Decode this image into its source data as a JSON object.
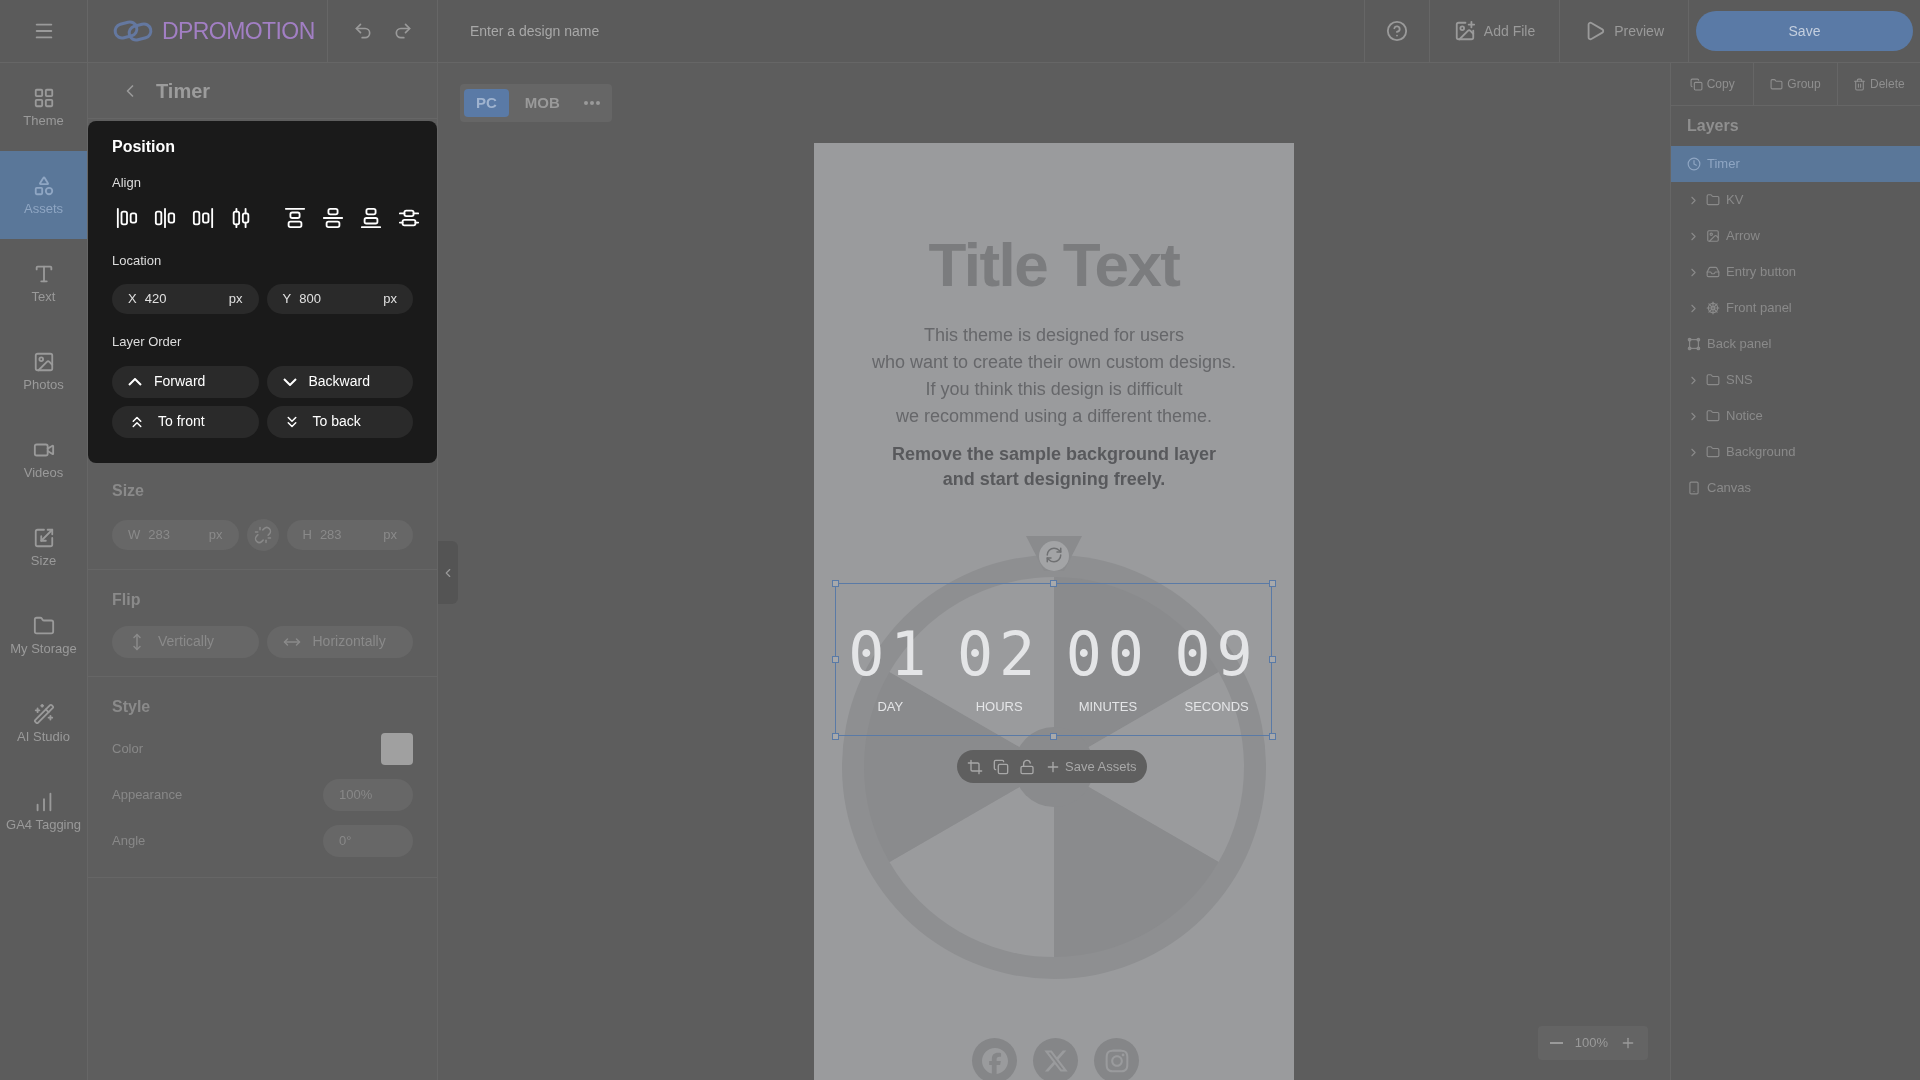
{
  "top_bar": {
    "logo": "DPROMOTION",
    "design_name": {
      "placeholder": "Enter a design name"
    },
    "actions": [
      {
        "label": "Add File",
        "kind": "add-image"
      },
      {
        "label": "Preview",
        "kind": "play"
      }
    ],
    "save": "Save"
  },
  "rail": [
    {
      "label": "Theme",
      "kind": "theme",
      "selected": false
    },
    {
      "label": "Assets",
      "kind": "assets",
      "selected": true
    },
    {
      "label": "Text",
      "kind": "text",
      "selected": false
    },
    {
      "label": "Photos",
      "kind": "photos",
      "selected": false
    },
    {
      "label": "Videos",
      "kind": "videos",
      "selected": false
    },
    {
      "label": "Size",
      "kind": "size",
      "selected": false
    },
    {
      "label": "My Storage",
      "kind": "storage",
      "selected": false
    },
    {
      "label": "AI Studio",
      "kind": "ai",
      "selected": false
    },
    {
      "label": "GA4 Tagging",
      "kind": "ga4",
      "selected": false
    }
  ],
  "panel": {
    "title": "Timer",
    "position": {
      "title": "Position",
      "align_label": "Align",
      "location_label": "Location",
      "x": {
        "axis": "X",
        "value": "420",
        "unit": "px"
      },
      "y": {
        "axis": "Y",
        "value": "800",
        "unit": "px"
      },
      "layer_order_label": "Layer Order",
      "order_buttons": [
        {
          "label": "Forward",
          "kind": "up"
        },
        {
          "label": "Backward",
          "kind": "down"
        },
        {
          "label": "To front",
          "kind": "top"
        },
        {
          "label": "To back",
          "kind": "bottom"
        }
      ]
    },
    "size": {
      "title": "Size",
      "w": {
        "axis": "W",
        "value": "283",
        "unit": "px"
      },
      "h": {
        "axis": "H",
        "value": "283",
        "unit": "px"
      }
    },
    "flip": {
      "title": "Flip",
      "buttons": [
        {
          "label": "Vertically",
          "kind": "vertical"
        },
        {
          "label": "Horizontally",
          "kind": "horizontal"
        }
      ]
    },
    "style": {
      "title": "Style",
      "color_label": "Color",
      "color": "#a0a0a0",
      "appearance_label": "Appearance",
      "appearance": "100%",
      "angle_label": "Angle",
      "angle": "0°"
    }
  },
  "view_tabs": [
    {
      "label": "PC",
      "selected": true
    },
    {
      "label": "MOB",
      "selected": false
    }
  ],
  "artboard": {
    "title": "Title Text",
    "body": [
      "This theme is designed for users",
      "who want to create their own custom designs.",
      "If you think this design is difficult",
      "we recommend using a different theme."
    ],
    "emphasis": [
      "Remove the sample background layer",
      "and start designing freely."
    ],
    "timer": [
      {
        "value": "01",
        "label": "DAY"
      },
      {
        "value": "02",
        "label": "HOURS"
      },
      {
        "value": "00",
        "label": "MINUTES"
      },
      {
        "value": "09",
        "label": "SECONDS"
      }
    ],
    "toolbar_action": "Save Assets"
  },
  "layer_actions": [
    {
      "label": "Copy",
      "kind": "copy"
    },
    {
      "label": "Group",
      "kind": "group"
    },
    {
      "label": "Delete",
      "kind": "delete"
    }
  ],
  "layers": {
    "title": "Layers",
    "items": [
      {
        "name": "Timer",
        "kind": "clock",
        "collapsible": false,
        "selected": true
      },
      {
        "name": "KV",
        "kind": "folder",
        "collapsible": true,
        "selected": false
      },
      {
        "name": "Arrow",
        "kind": "image",
        "collapsible": true,
        "selected": false
      },
      {
        "name": "Entry button",
        "kind": "button",
        "collapsible": true,
        "selected": false
      },
      {
        "name": "Front panel",
        "kind": "wheel",
        "collapsible": true,
        "selected": false
      },
      {
        "name": "Back panel",
        "kind": "frame",
        "collapsible": false,
        "selected": false
      },
      {
        "name": "SNS",
        "kind": "folder",
        "collapsible": true,
        "selected": false
      },
      {
        "name": "Notice",
        "kind": "folder",
        "collapsible": true,
        "selected": false
      },
      {
        "name": "Background",
        "kind": "folder",
        "collapsible": true,
        "selected": false
      },
      {
        "name": "Canvas",
        "kind": "phone",
        "collapsible": false,
        "selected": false
      }
    ]
  },
  "zoom": "100%"
}
